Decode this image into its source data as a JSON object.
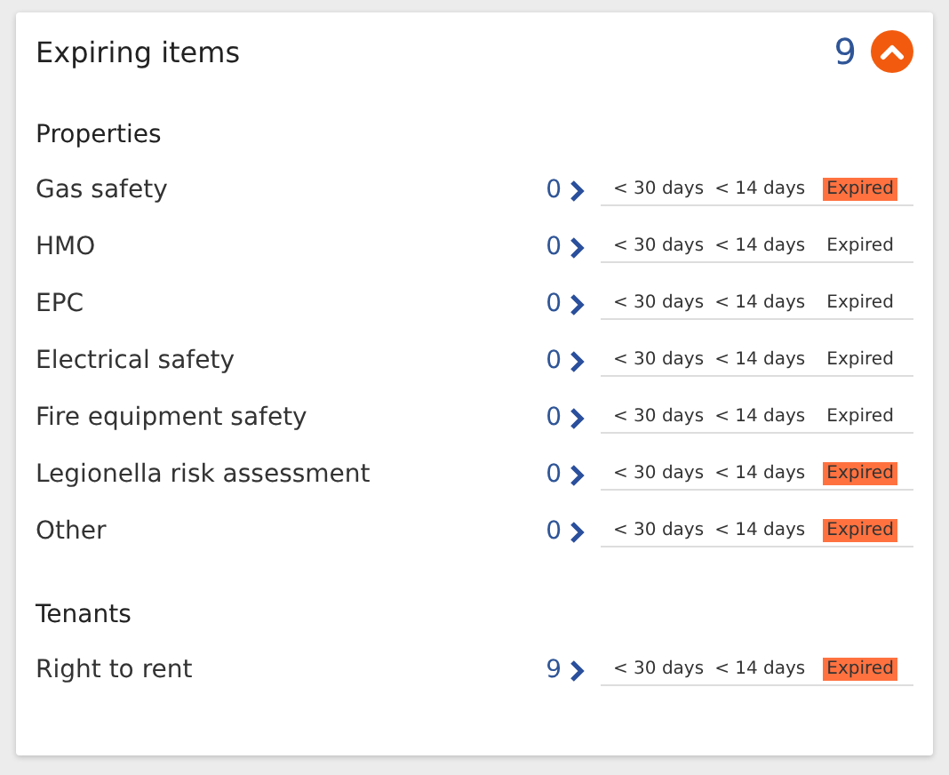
{
  "panel": {
    "title": "Expiring items",
    "count": "9",
    "expanded": true
  },
  "sections": [
    {
      "title": "Properties",
      "rows": [
        {
          "label": "Gas safety",
          "count": "0",
          "buckets": [
            {
              "label": "< 30 days",
              "highlighted": false
            },
            {
              "label": "< 14 days",
              "highlighted": false
            },
            {
              "label": "Expired",
              "highlighted": true
            }
          ]
        },
        {
          "label": "HMO",
          "count": "0",
          "buckets": [
            {
              "label": "< 30 days",
              "highlighted": false
            },
            {
              "label": "< 14 days",
              "highlighted": false
            },
            {
              "label": "Expired",
              "highlighted": false
            }
          ]
        },
        {
          "label": "EPC",
          "count": "0",
          "buckets": [
            {
              "label": "< 30 days",
              "highlighted": false
            },
            {
              "label": "< 14 days",
              "highlighted": false
            },
            {
              "label": "Expired",
              "highlighted": false
            }
          ]
        },
        {
          "label": "Electrical safety",
          "count": "0",
          "buckets": [
            {
              "label": "< 30 days",
              "highlighted": false
            },
            {
              "label": "< 14 days",
              "highlighted": false
            },
            {
              "label": "Expired",
              "highlighted": false
            }
          ]
        },
        {
          "label": "Fire equipment safety",
          "count": "0",
          "buckets": [
            {
              "label": "< 30 days",
              "highlighted": false
            },
            {
              "label": "< 14 days",
              "highlighted": false
            },
            {
              "label": "Expired",
              "highlighted": false
            }
          ]
        },
        {
          "label": "Legionella risk assessment",
          "count": "0",
          "buckets": [
            {
              "label": "< 30 days",
              "highlighted": false
            },
            {
              "label": "< 14 days",
              "highlighted": false
            },
            {
              "label": "Expired",
              "highlighted": true
            }
          ]
        },
        {
          "label": "Other",
          "count": "0",
          "buckets": [
            {
              "label": "< 30 days",
              "highlighted": false
            },
            {
              "label": "< 14 days",
              "highlighted": false
            },
            {
              "label": "Expired",
              "highlighted": true
            }
          ]
        }
      ]
    },
    {
      "title": "Tenants",
      "rows": [
        {
          "label": "Right to rent",
          "count": "9",
          "buckets": [
            {
              "label": "< 30 days",
              "highlighted": false
            },
            {
              "label": "< 14 days",
              "highlighted": false
            },
            {
              "label": "Expired",
              "highlighted": true
            }
          ]
        }
      ]
    }
  ]
}
